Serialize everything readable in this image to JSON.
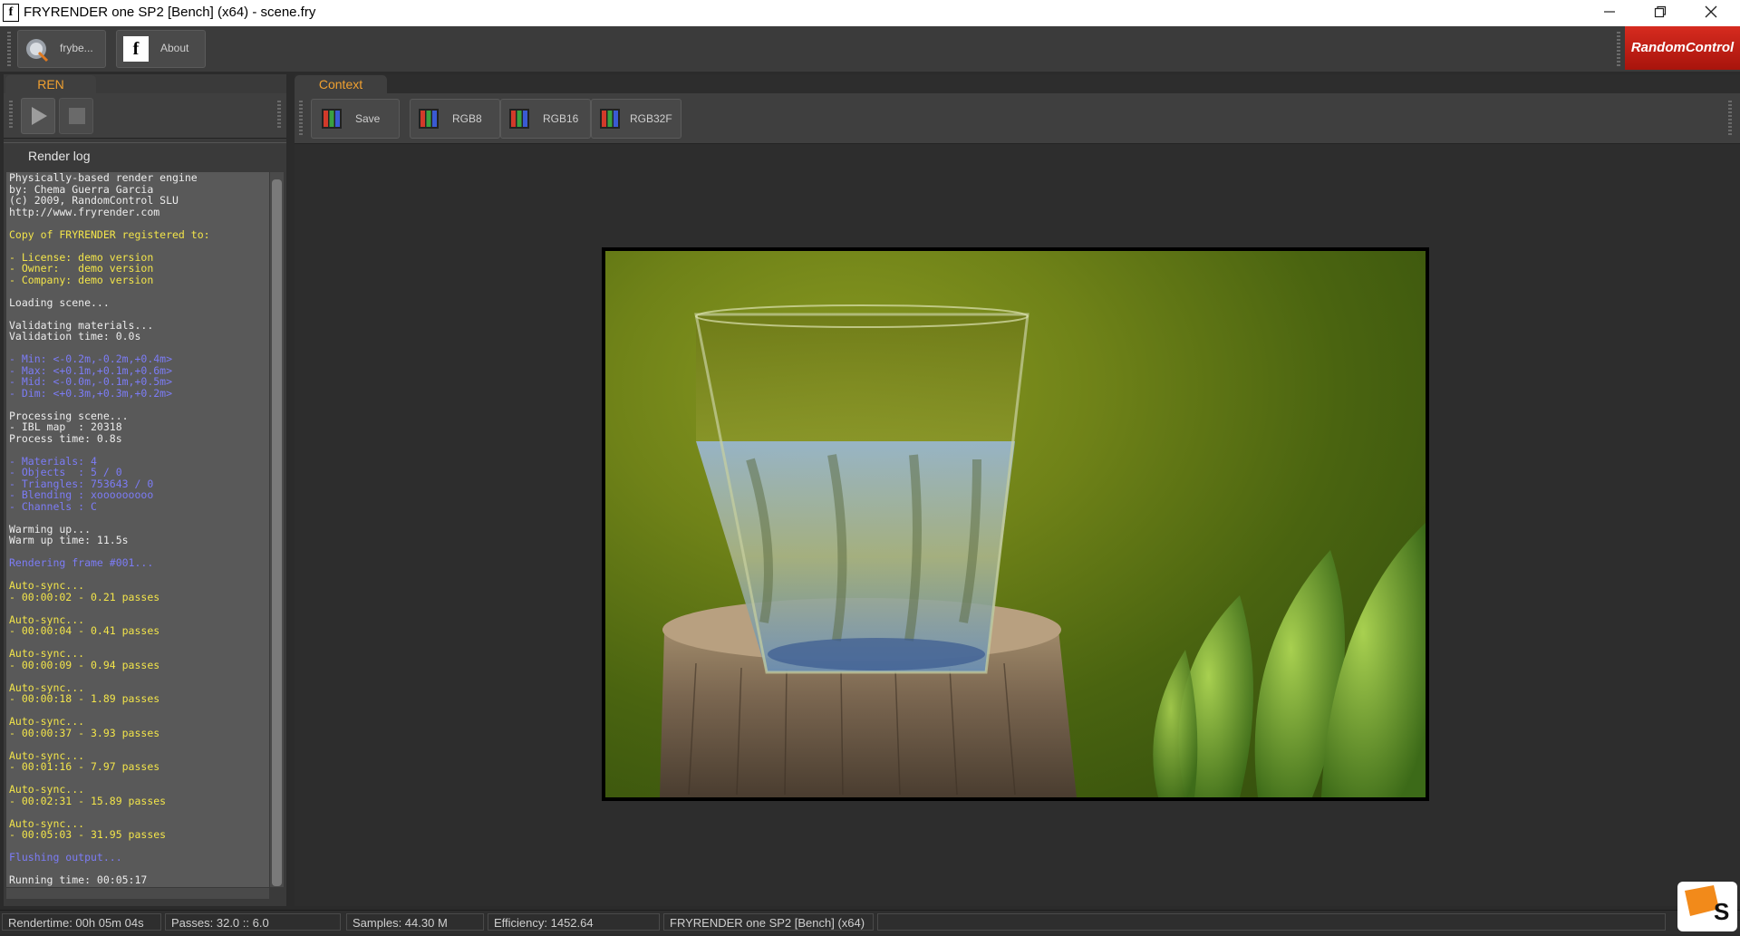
{
  "window": {
    "title": "FRYRENDER one SP2 [Bench] (x64) - scene.fry",
    "app_icon": "f",
    "controls": [
      "minimize-icon",
      "restore-icon",
      "close-icon"
    ]
  },
  "toolbar": {
    "frybench_label": "frybe...",
    "about_label": "About",
    "about_icon_text": "f",
    "brand": "RandomControl"
  },
  "left_panel": {
    "tab": "REN",
    "play_icon": "play-icon",
    "stop_icon": "stop-icon",
    "render_log_label": "Render log",
    "log": [
      {
        "t": "Physically-based render engine",
        "c": "white"
      },
      {
        "t": "by: Chema Guerra Garcia",
        "c": "white"
      },
      {
        "t": "(c) 2009, RandomControl SLU",
        "c": "white"
      },
      {
        "t": "http://www.fryrender.com",
        "c": "white"
      },
      {
        "t": "",
        "c": "white"
      },
      {
        "t": "Copy of FRYRENDER registered to:",
        "c": "yellow"
      },
      {
        "t": "",
        "c": "white"
      },
      {
        "t": "- License: demo version",
        "c": "yellow"
      },
      {
        "t": "- Owner:   demo version",
        "c": "yellow"
      },
      {
        "t": "- Company: demo version",
        "c": "yellow"
      },
      {
        "t": "",
        "c": "white"
      },
      {
        "t": "Loading scene...",
        "c": "white"
      },
      {
        "t": "",
        "c": "white"
      },
      {
        "t": "Validating materials...",
        "c": "white"
      },
      {
        "t": "Validation time: 0.0s",
        "c": "white"
      },
      {
        "t": "",
        "c": "white"
      },
      {
        "t": "- Min: <-0.2m,-0.2m,+0.4m>",
        "c": "blue"
      },
      {
        "t": "- Max: <+0.1m,+0.1m,+0.6m>",
        "c": "blue"
      },
      {
        "t": "- Mid: <-0.0m,-0.1m,+0.5m>",
        "c": "blue"
      },
      {
        "t": "- Dim: <+0.3m,+0.3m,+0.2m>",
        "c": "blue"
      },
      {
        "t": "",
        "c": "white"
      },
      {
        "t": "Processing scene...",
        "c": "white"
      },
      {
        "t": "- IBL map  : 20318",
        "c": "white"
      },
      {
        "t": "Process time: 0.8s",
        "c": "white"
      },
      {
        "t": "",
        "c": "white"
      },
      {
        "t": "- Materials: 4",
        "c": "blue"
      },
      {
        "t": "- Objects  : 5 / 0",
        "c": "blue"
      },
      {
        "t": "- Triangles: 753643 / 0",
        "c": "blue"
      },
      {
        "t": "- Blending : xooooooooo",
        "c": "blue"
      },
      {
        "t": "- Channels : C",
        "c": "blue"
      },
      {
        "t": "",
        "c": "white"
      },
      {
        "t": "Warming up...",
        "c": "white"
      },
      {
        "t": "Warm up time: 11.5s",
        "c": "white"
      },
      {
        "t": "",
        "c": "white"
      },
      {
        "t": "Rendering frame #001...",
        "c": "blue"
      },
      {
        "t": "",
        "c": "white"
      },
      {
        "t": "Auto-sync...",
        "c": "yellow"
      },
      {
        "t": "- 00:00:02 - 0.21 passes",
        "c": "yellow"
      },
      {
        "t": "",
        "c": "white"
      },
      {
        "t": "Auto-sync...",
        "c": "yellow"
      },
      {
        "t": "- 00:00:04 - 0.41 passes",
        "c": "yellow"
      },
      {
        "t": "",
        "c": "white"
      },
      {
        "t": "Auto-sync...",
        "c": "yellow"
      },
      {
        "t": "- 00:00:09 - 0.94 passes",
        "c": "yellow"
      },
      {
        "t": "",
        "c": "white"
      },
      {
        "t": "Auto-sync...",
        "c": "yellow"
      },
      {
        "t": "- 00:00:18 - 1.89 passes",
        "c": "yellow"
      },
      {
        "t": "",
        "c": "white"
      },
      {
        "t": "Auto-sync...",
        "c": "yellow"
      },
      {
        "t": "- 00:00:37 - 3.93 passes",
        "c": "yellow"
      },
      {
        "t": "",
        "c": "white"
      },
      {
        "t": "Auto-sync...",
        "c": "yellow"
      },
      {
        "t": "- 00:01:16 - 7.97 passes",
        "c": "yellow"
      },
      {
        "t": "",
        "c": "white"
      },
      {
        "t": "Auto-sync...",
        "c": "yellow"
      },
      {
        "t": "- 00:02:31 - 15.89 passes",
        "c": "yellow"
      },
      {
        "t": "",
        "c": "white"
      },
      {
        "t": "Auto-sync...",
        "c": "yellow"
      },
      {
        "t": "- 00:05:03 - 31.95 passes",
        "c": "yellow"
      },
      {
        "t": "",
        "c": "white"
      },
      {
        "t": "Flushing output...",
        "c": "blue"
      },
      {
        "t": "",
        "c": "white"
      },
      {
        "t": "Running time: 00:05:17",
        "c": "white"
      }
    ]
  },
  "context": {
    "tab": "Context",
    "save_label": "Save",
    "rgb8_label": "RGB8",
    "rgb16_label": "RGB16",
    "rgb32f_label": "RGB32F"
  },
  "colors": {
    "log_white": "#ececec",
    "log_yellow": "#f2e44a",
    "log_blue": "#7c7cf6",
    "tab_accent": "#f0a030",
    "brand_red": "#c41e14"
  },
  "status": {
    "rendertime": "Rendertime: 00h 05m 04s",
    "passes": "Passes: 32.0 :: 6.0",
    "samples": "Samples: 44.30 M",
    "efficiency": "Efficiency: 1452.64",
    "product": "FRYRENDER one SP2 [Bench] (x64)"
  }
}
